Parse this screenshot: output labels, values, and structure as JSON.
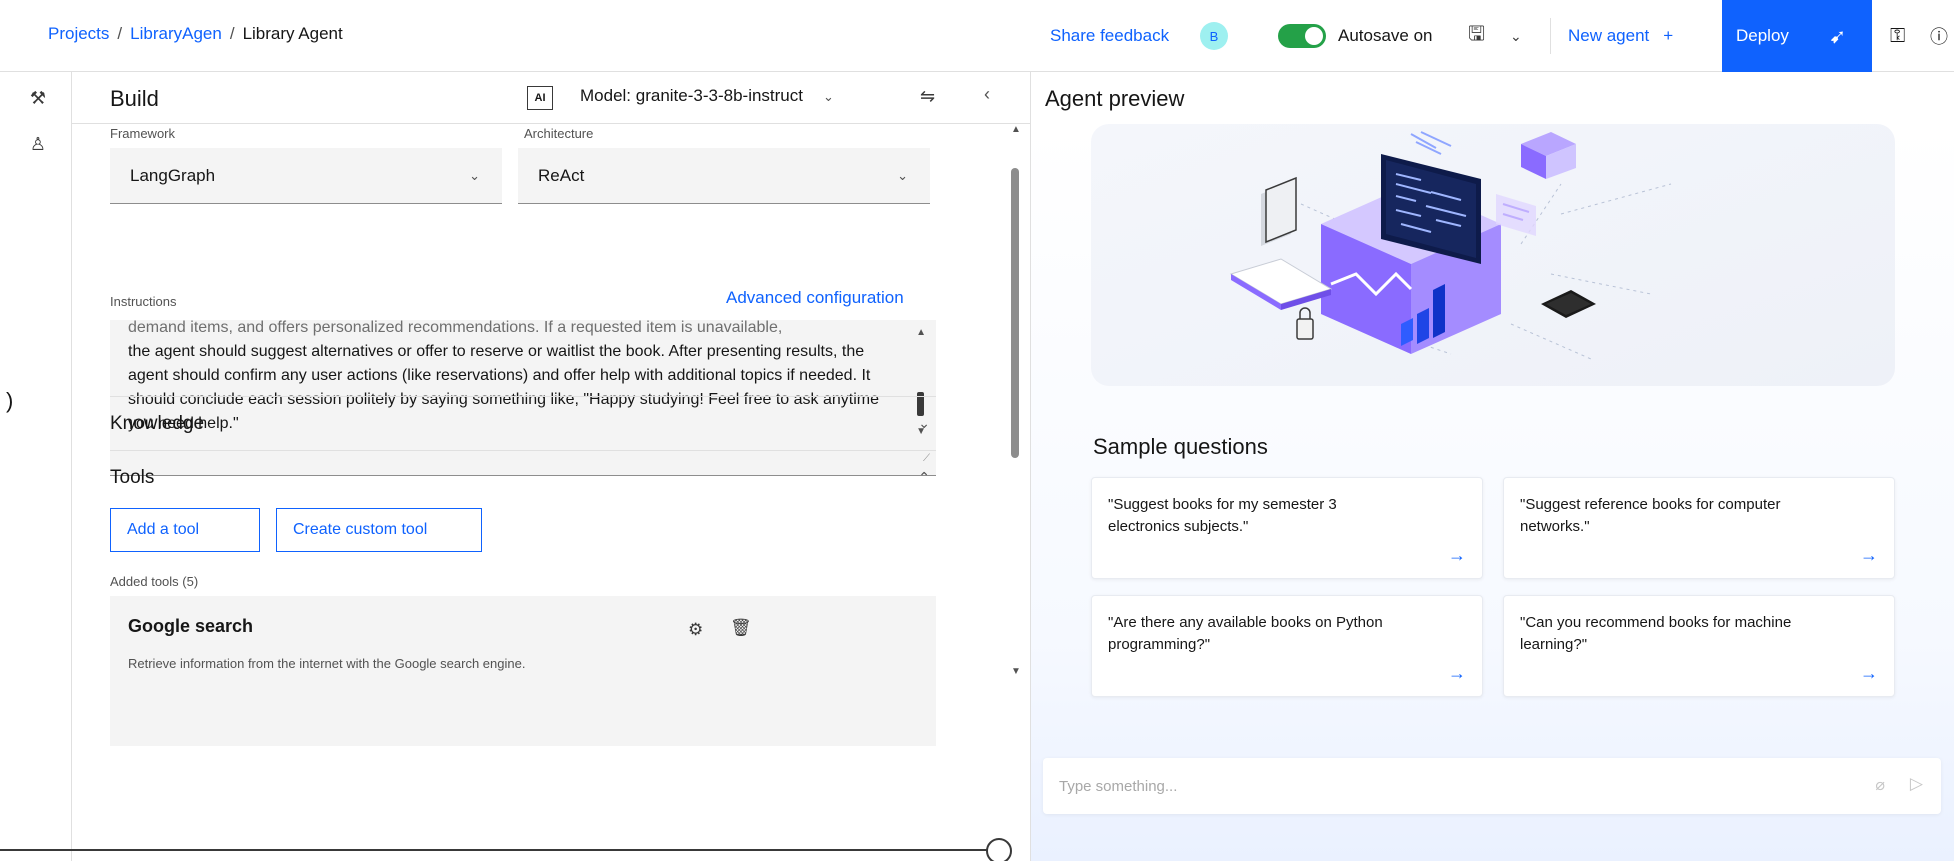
{
  "topbar": {
    "breadcrumb": [
      "Projects",
      "LibraryAgen",
      "Library Agent"
    ],
    "share_feedback": "Share feedback",
    "avatar_initial": "B",
    "autosave_label": "Autosave on",
    "new_agent": "New agent",
    "new_agent_icon": "+",
    "deploy": "Deploy",
    "autosave_on": true,
    "icons": [
      "save-icon",
      "chevron-down-icon",
      "rocket-icon",
      "lock-icon",
      "info-icon"
    ],
    "accent_color": "#0f62fe",
    "toggle_color": "#24a148"
  },
  "rail": {
    "icons": [
      "tools-icon",
      "user-icon"
    ]
  },
  "build": {
    "title": "Build",
    "ai_badge": "AI",
    "model_label": "Model: granite-3-3-8b-instruct",
    "framework": {
      "label": "Framework",
      "value": "LangGraph"
    },
    "architecture": {
      "label": "Architecture",
      "value": "ReAct"
    },
    "instructions": {
      "label": "Instructions",
      "advanced_link": "Advanced configuration",
      "cut_line": "demand items, and offers personalized recommendations. If a requested item is unavailable,",
      "text": "the agent should suggest alternatives or offer to reserve or waitlist the book. After presenting results, the agent should confirm any user actions (like reservations) and offer help with additional topics if needed. It should conclude each session politely by saying something like, \"Happy studying! Feel free to ask anytime you need help.\""
    },
    "knowledge": {
      "label": "Knowledge"
    },
    "tools": {
      "label": "Tools",
      "add_tool": "Add a tool",
      "create_custom_tool": "Create custom tool",
      "added_label": "Added tools (5)",
      "items": [
        {
          "name": "Google search",
          "description": "Retrieve information from the internet with the Google search engine."
        }
      ]
    }
  },
  "preview": {
    "title": "Agent preview",
    "sample_title": "Sample questions",
    "questions": [
      "\"Suggest books for my semester 3 electronics subjects.\"",
      "\"Suggest reference books for computer networks.\"",
      "\"Are there any available books on Python programming?\"",
      "\"Can you recommend books for machine learning?\""
    ],
    "input_placeholder": "Type something..."
  }
}
